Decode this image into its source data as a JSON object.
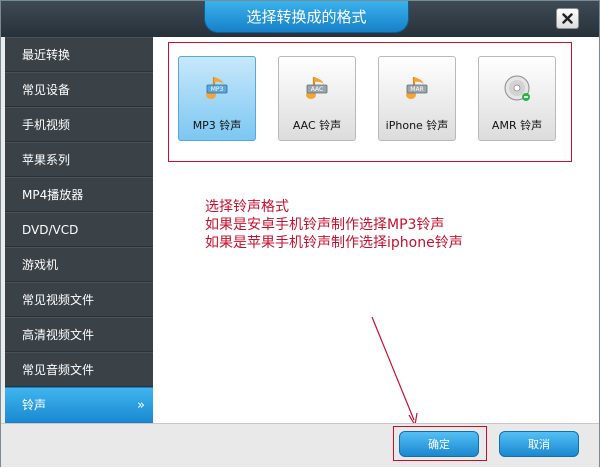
{
  "window": {
    "title": "选择转换成的格式",
    "close_glyph": "×"
  },
  "sidebar": {
    "items": [
      {
        "label": "最近转换"
      },
      {
        "label": "常见设备"
      },
      {
        "label": "手机视频"
      },
      {
        "label": "苹果系列"
      },
      {
        "label": "MP4播放器"
      },
      {
        "label": "DVD/VCD"
      },
      {
        "label": "游戏机"
      },
      {
        "label": "常见视频文件"
      },
      {
        "label": "高清视频文件"
      },
      {
        "label": "常见音频文件"
      },
      {
        "label": "铃声",
        "active": true,
        "chevron": "»"
      }
    ]
  },
  "formats": [
    {
      "label": "MP3 铃声",
      "icon": "mp3-note-icon",
      "badge": "MP3",
      "selected": true
    },
    {
      "label": "AAC 铃声",
      "icon": "aac-note-icon",
      "badge": "AAC",
      "selected": false
    },
    {
      "label": "iPhone 铃声",
      "icon": "mar-note-icon",
      "badge": "MAR",
      "selected": false
    },
    {
      "label": "AMR 铃声",
      "icon": "cd-disc-icon",
      "badge": "",
      "selected": false
    }
  ],
  "annotation": {
    "line1": "选择铃声格式",
    "line2": "如果是安卓手机铃声制作选择MP3铃声",
    "line3": "如果是苹果手机铃声制作选择iphone铃声"
  },
  "footer": {
    "ok_label": "确定",
    "cancel_label": "取消"
  },
  "colors": {
    "annotation_red": "#c8102e",
    "accent_blue": "#1a89d3",
    "sidebar_bg": "#3a4147"
  }
}
